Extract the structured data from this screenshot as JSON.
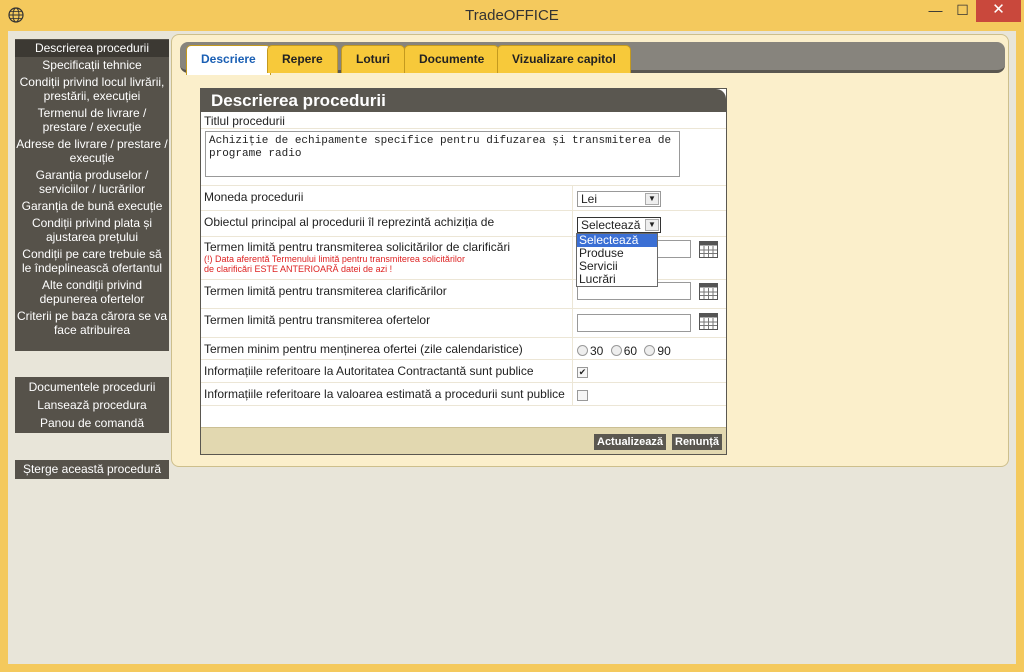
{
  "window": {
    "title": "TradeOFFICE",
    "minimize": "—",
    "maximize": "☐",
    "close": "✕"
  },
  "nav": {
    "group1": [
      "Descrierea procedurii",
      "Specificații tehnice",
      "Condiții privind locul livrării, prestării, execuției",
      "Termenul de livrare / prestare / execuție",
      "Adrese de livrare / prestare / execuție",
      "Garanția produselor / serviciilor / lucrărilor",
      "Garanția de bună execuție",
      "Condiții privind plata și ajustarea prețului",
      "Condiții pe care trebuie să le îndeplinească ofertantul",
      "Alte condiții privind depunerea ofertelor",
      "Criterii pe baza cărora se va face atribuirea"
    ],
    "group2": [
      "Documentele procedurii",
      "Lansează procedura",
      "Panou de comandă"
    ],
    "delete": "Șterge această procedură"
  },
  "tabs": [
    "Descriere",
    "Repere",
    "Loturi",
    "Documente",
    "Vizualizare capitol"
  ],
  "panel": {
    "header": "Descrierea procedurii",
    "title_label": "Titlul procedurii",
    "title_value": "Achiziție de echipamente specifice pentru difuzarea și transmiterea de programe radio",
    "currency_label": "Moneda procedurii",
    "currency_value": "Lei",
    "object_label": "Obiectul principal al procedurii îl reprezintă achiziția de",
    "object_value": "Selectează",
    "object_options": [
      "Selectează",
      "Produse",
      "Servicii",
      "Lucrări"
    ],
    "clarif_req_label": "Termen limită pentru transmiterea solicitărilor de clarificări",
    "clarif_req_warning_1": "(!) Data aferentă Termenului limită pentru transmiterea solicitărilor",
    "clarif_req_warning_2": "de clarificări ESTE ANTERIOARĂ datei de azi !",
    "clarif_label": "Termen limită pentru transmiterea clarificărilor",
    "offers_label": "Termen limită pentru transmiterea ofertelor",
    "validity_label": "Termen minim pentru menținerea ofertei (zile calendaristice)",
    "validity_options": [
      "30",
      "60",
      "90"
    ],
    "authority_public_label": "Informațiile referitoare la Autoritatea Contractantă sunt publice",
    "authority_public_checked": "✔",
    "value_public_label": "Informațiile referitoare la valoarea estimată a procedurii sunt publice",
    "update_button": "Actualizează",
    "cancel_button": "Renunță"
  },
  "icons": {
    "app": "globe-icon",
    "calendar": "calendar-icon"
  }
}
